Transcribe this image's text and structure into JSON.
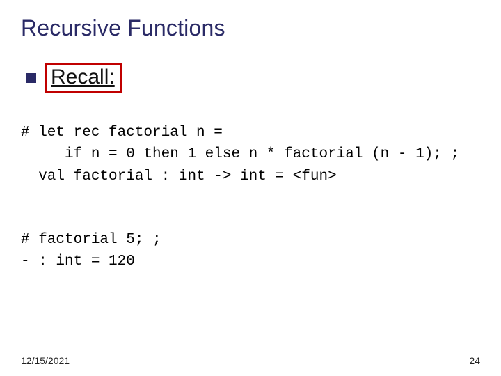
{
  "title": "Recursive Functions",
  "recall": "Recall:",
  "code1_l1": "# let rec factorial n =",
  "code1_l2": "     if n = 0 then 1 else n * factorial (n - 1); ;",
  "code1_l3": "  val factorial : int -> int = <fun>",
  "code2_l1": "# factorial 5; ;",
  "code2_l2": "- : int = 120",
  "footer_date": "12/15/2021",
  "footer_page": "24"
}
